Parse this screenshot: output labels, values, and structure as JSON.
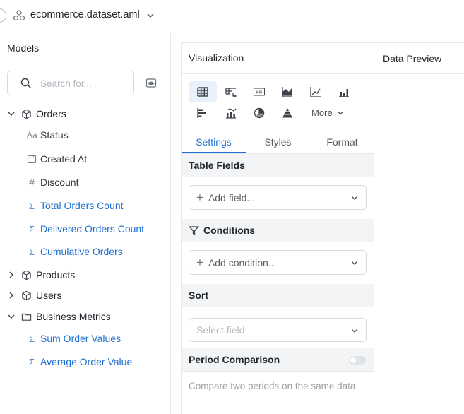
{
  "header": {
    "dataset_title": "ecommerce.dataset.aml"
  },
  "models": {
    "title": "Models",
    "search": {
      "placeholder": "Search for...",
      "value": ""
    },
    "tree": [
      {
        "label": "Orders",
        "kind": "model",
        "expanded": true
      },
      {
        "label": "Status",
        "kind": "dimension-text"
      },
      {
        "label": "Created At",
        "kind": "dimension-date"
      },
      {
        "label": "Discount",
        "kind": "dimension-number"
      },
      {
        "label": "Total Orders Count",
        "kind": "measure"
      },
      {
        "label": "Delivered Orders Count",
        "kind": "measure"
      },
      {
        "label": "Cumulative Orders",
        "kind": "measure"
      },
      {
        "label": "Products",
        "kind": "model",
        "expanded": false
      },
      {
        "label": "Users",
        "kind": "model",
        "expanded": false
      },
      {
        "label": "Business Metrics",
        "kind": "folder",
        "expanded": true
      },
      {
        "label": "Sum Order Values",
        "kind": "measure"
      },
      {
        "label": "Average Order Value",
        "kind": "measure"
      }
    ],
    "text_glyph": "Aa",
    "number_glyph": "#",
    "measure_glyph": "Σ"
  },
  "visualization": {
    "title": "Visualization",
    "kpi_icon_text": "KPI",
    "more_label": "More",
    "tabs": [
      {
        "label": "Settings",
        "active": true
      },
      {
        "label": "Styles",
        "active": false
      },
      {
        "label": "Format",
        "active": false
      }
    ],
    "table_fields": {
      "title": "Table Fields",
      "add_label": "Add field..."
    },
    "conditions": {
      "title": "Conditions",
      "add_label": "Add condition..."
    },
    "sort": {
      "title": "Sort",
      "placeholder": "Select field"
    },
    "period_comparison": {
      "title": "Period Comparison",
      "enabled": false,
      "helper": "Compare two periods on the same data."
    }
  },
  "preview": {
    "title": "Data Preview"
  },
  "colors": {
    "accent": "#1d6fd1",
    "measure": "#1d6fd1",
    "active_icon_bg": "#e8f1fb",
    "section_bg": "#f3f4f6"
  }
}
